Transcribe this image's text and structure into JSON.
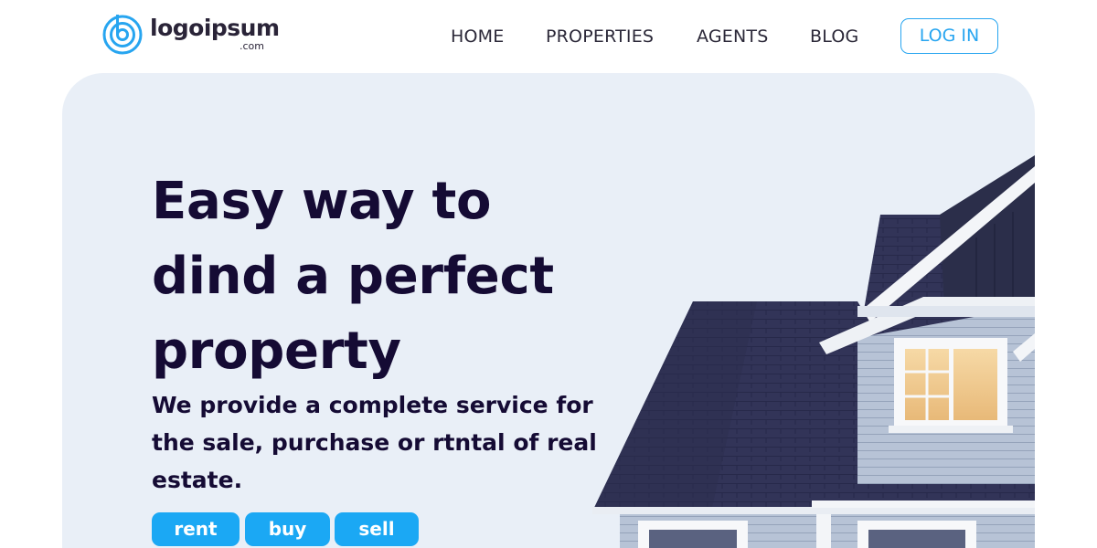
{
  "brand": {
    "name": "logoipsum",
    "suffix": ".com",
    "color": "#27a5f0"
  },
  "nav": {
    "items": [
      {
        "label": "HOME"
      },
      {
        "label": "PROPERTIES"
      },
      {
        "label": "AGENTS"
      },
      {
        "label": "BLOG"
      }
    ],
    "login_label": "LOG IN"
  },
  "hero": {
    "headline_lines": [
      "Easy way to",
      "dind a perfect",
      "property"
    ],
    "subtext": "We provide a complete service for the sale, purchase or rtntal of real estate.",
    "buttons": [
      {
        "label": "rent"
      },
      {
        "label": "buy"
      },
      {
        "label": "sell"
      }
    ],
    "background_color": "#e9eff7",
    "button_color": "#1ba8f4",
    "image": "house-photo"
  }
}
